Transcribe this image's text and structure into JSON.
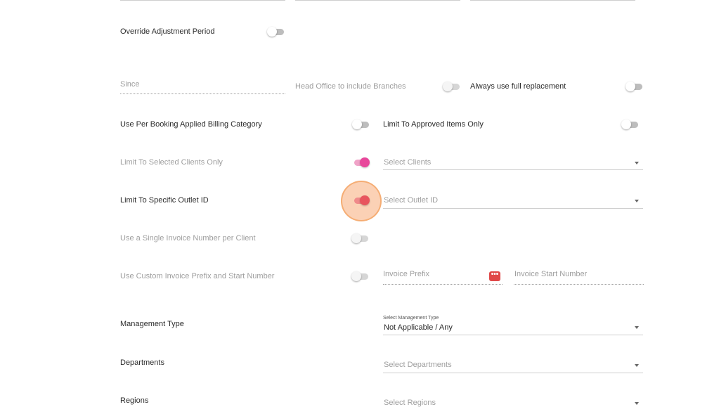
{
  "top_fields": [
    "",
    "",
    ""
  ],
  "override_adjustment": {
    "label": "Override Adjustment Period",
    "on": false
  },
  "since": {
    "placeholder": "Since"
  },
  "head_office": {
    "label": "Head Office to include Branches",
    "on": false
  },
  "full_replacement": {
    "label": "Always use full replacement",
    "on": false
  },
  "per_booking": {
    "label": "Use Per Booking Applied Billing Category",
    "on": false
  },
  "approved_items": {
    "label": "Limit To Approved Items Only",
    "on": false
  },
  "selected_clients": {
    "label": "Limit To Selected Clients Only",
    "on": true,
    "select_placeholder": "Select Clients"
  },
  "outlet_id": {
    "label": "Limit To Specific Outlet ID",
    "on": true,
    "select_placeholder": "Select Outlet ID"
  },
  "single_invoice": {
    "label": "Use a Single Invoice Number per Client",
    "on": false
  },
  "custom_prefix": {
    "label": "Use Custom Invoice Prefix and Start Number",
    "on": false,
    "prefix_placeholder": "Invoice Prefix",
    "start_placeholder": "Invoice Start Number",
    "icon_text": "•••"
  },
  "management_type": {
    "label": "Management Type",
    "caption": "Select Management Type",
    "value": "Not Applicable / Any"
  },
  "departments": {
    "label": "Departments",
    "select_placeholder": "Select Departments"
  },
  "regions": {
    "label": "Regions",
    "select_placeholder": "Select Regions"
  },
  "colors": {
    "accent_pink": "#e8479b",
    "accent_red": "#e8555e",
    "highlight": "#f5aa6e"
  }
}
